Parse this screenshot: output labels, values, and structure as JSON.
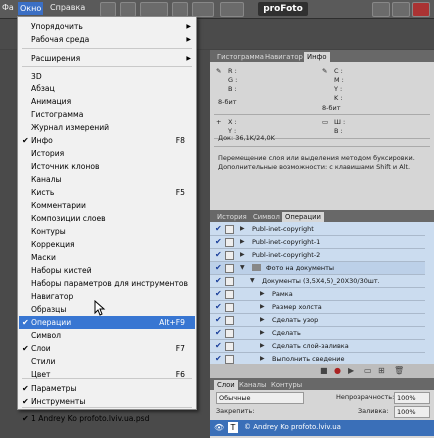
{
  "menubar": {
    "items": [
      "Фа",
      "Окно",
      "Справка"
    ],
    "profoto": "proFoto"
  },
  "menu": {
    "items": [
      {
        "label": "Упорядочить",
        "shortcut": "",
        "check": false,
        "submenu": true
      },
      {
        "label": "Рабочая среда",
        "shortcut": "",
        "check": false,
        "submenu": true
      },
      {
        "label": "Расширения",
        "shortcut": "",
        "check": false,
        "submenu": true
      },
      {
        "label": "3D",
        "shortcut": "",
        "check": false,
        "submenu": false
      },
      {
        "label": "Абзац",
        "shortcut": "",
        "check": false,
        "submenu": false
      },
      {
        "label": "Анимация",
        "shortcut": "",
        "check": false,
        "submenu": false
      },
      {
        "label": "Гистограмма",
        "shortcut": "",
        "check": false,
        "submenu": false
      },
      {
        "label": "Журнал измерений",
        "shortcut": "",
        "check": false,
        "submenu": false
      },
      {
        "label": "Инфо",
        "shortcut": "F8",
        "check": true,
        "submenu": false
      },
      {
        "label": "История",
        "shortcut": "",
        "check": false,
        "submenu": false
      },
      {
        "label": "Источник клонов",
        "shortcut": "",
        "check": false,
        "submenu": false
      },
      {
        "label": "Каналы",
        "shortcut": "",
        "check": false,
        "submenu": false
      },
      {
        "label": "Кисть",
        "shortcut": "F5",
        "check": false,
        "submenu": false
      },
      {
        "label": "Комментарии",
        "shortcut": "",
        "check": false,
        "submenu": false
      },
      {
        "label": "Композиции слоев",
        "shortcut": "",
        "check": false,
        "submenu": false
      },
      {
        "label": "Контуры",
        "shortcut": "",
        "check": false,
        "submenu": false
      },
      {
        "label": "Коррекция",
        "shortcut": "",
        "check": false,
        "submenu": false
      },
      {
        "label": "Маски",
        "shortcut": "",
        "check": false,
        "submenu": false
      },
      {
        "label": "Наборы кистей",
        "shortcut": "",
        "check": false,
        "submenu": false
      },
      {
        "label": "Наборы параметров для инструментов",
        "shortcut": "",
        "check": false,
        "submenu": false
      },
      {
        "label": "Навигатор",
        "shortcut": "",
        "check": false,
        "submenu": false
      },
      {
        "label": "Образцы",
        "shortcut": "",
        "check": false,
        "submenu": false
      },
      {
        "label": "Операции",
        "shortcut": "Alt+F9",
        "check": true,
        "submenu": false,
        "highlight": true
      },
      {
        "label": "Символ",
        "shortcut": "",
        "check": false,
        "submenu": false
      },
      {
        "label": "Слои",
        "shortcut": "F7",
        "check": true,
        "submenu": false
      },
      {
        "label": "Стили",
        "shortcut": "",
        "check": false,
        "submenu": false
      },
      {
        "label": "Цвет",
        "shortcut": "F6",
        "check": false,
        "submenu": false
      },
      {
        "label": "Параметры",
        "shortcut": "",
        "check": true,
        "submenu": false
      },
      {
        "label": "Инструменты",
        "shortcut": "",
        "check": true,
        "submenu": false
      },
      {
        "label": "1 Andrey Ko     profoto.lviv.ua.psd",
        "shortcut": "",
        "check": true,
        "submenu": false
      }
    ]
  },
  "info_panel": {
    "tabs": [
      "Гистограмма",
      "Навигатор",
      "Инфо"
    ],
    "r": "R :",
    "g": "G :",
    "b": "B :",
    "c": "C :",
    "m": "M :",
    "y": "Y :",
    "k": "K :",
    "bits_left": "8-бит",
    "bits_right": "8-бит",
    "x": "X :",
    "yy": "Y :",
    "w": "Ш :",
    "h": "В :",
    "doc": "Док: 36,1K/24,0K",
    "hint1": "Перемещение слоя или выделения методом буксировки.",
    "hint2": "Дополнительные возможности: с клавишами Shift и Alt."
  },
  "actions_panel": {
    "tabs": [
      "История",
      "Символ",
      "Операции"
    ],
    "rows": [
      "Publ-inet-copyright",
      "Publ-inet-copyright-1",
      "Publ-inet-copyright-2",
      "Фото на документы",
      "Документы (3,5X4,5)_20X30/30шт.",
      "Рамка",
      "Размер холста",
      "Сделать узор",
      "Сделать",
      "Сделать слой-заливка",
      "Выполнить сведение"
    ]
  },
  "layers_panel": {
    "tabs": [
      "Слои",
      "Каналы",
      "Контуры"
    ],
    "blend": "Обычные",
    "opacity_label": "Непрозрачность:",
    "opacity": "100%",
    "lock_label": "Закрепить:",
    "fill_label": "Заливка:",
    "fill": "100%",
    "layer_name": "© Andrey Ko   profoto.lviv.ua"
  }
}
